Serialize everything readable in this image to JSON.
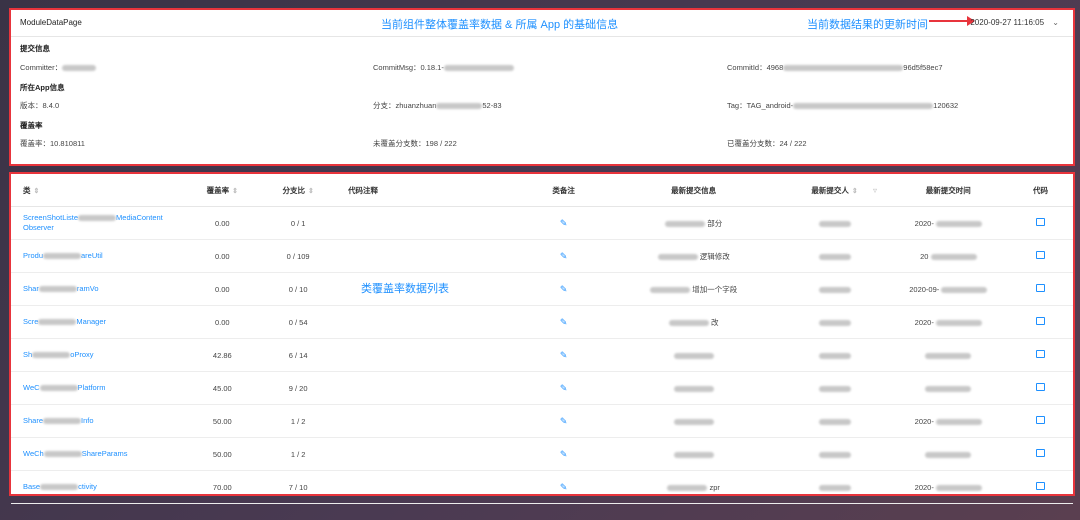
{
  "header": {
    "page_name": "ModuleDataPage",
    "annotation_center": "当前组件整体覆盖率数据 & 所属 App 的基础信息",
    "annotation_right": "当前数据结果的更新时间",
    "date_value": "2020-09-27 11:16:05"
  },
  "info": {
    "commit_section": "提交信息",
    "committer": "Committer：",
    "commit_msg": "CommitMsg：0.18.1-",
    "commit_id": "CommitId：4968",
    "commit_id_tail": "96d5f58ec7",
    "app_section": "所在App信息",
    "version": "版本：8.4.0",
    "branch": "分支：zhuanzhuan",
    "branch_tail": "52-83",
    "tag": "Tag：TAG_android-",
    "tag_tail": "120632",
    "coverage_section": "覆盖率",
    "coverage": "覆盖率：10.810811",
    "uncovered": "未覆盖分支数：198 / 222",
    "covered": "已覆盖分支数：24 / 222"
  },
  "table": {
    "annotation": "类覆盖率数据列表",
    "columns": {
      "cls": "类",
      "rate": "覆盖率",
      "ratio": "分支比",
      "note": "代码注释",
      "remark": "类备注",
      "latest_info": "最新提交信息",
      "latest_user": "最新提交人",
      "latest_time": "最新提交时间",
      "code": "代码"
    },
    "rows": [
      {
        "cls1": "ScreenShotListe",
        "cls2": "MediaContent",
        "cls3": "Observer",
        "rate": "0.00",
        "ratio": "0 / 1",
        "info": "部分",
        "time": "2020-"
      },
      {
        "cls1": "Produ",
        "cls2": "areUtil",
        "cls3": "",
        "rate": "0.00",
        "ratio": "0 / 109",
        "info": "逻辑修改",
        "time": "20"
      },
      {
        "cls1": "Shar",
        "cls2": "ramVo",
        "cls3": "",
        "rate": "0.00",
        "ratio": "0 / 10",
        "info": "增加一个字段",
        "time": "2020-09-"
      },
      {
        "cls1": "Scre",
        "cls2": "Manager",
        "cls3": "",
        "rate": "0.00",
        "ratio": "0 / 54",
        "info": "改",
        "time": "2020-"
      },
      {
        "cls1": "Sh",
        "cls2": "oProxy",
        "cls3": "",
        "rate": "42.86",
        "ratio": "6 / 14",
        "info": "",
        "time": ""
      },
      {
        "cls1": "WeC",
        "cls2": "Platform",
        "cls3": "",
        "rate": "45.00",
        "ratio": "9 / 20",
        "info": "",
        "time": ""
      },
      {
        "cls1": "Share",
        "cls2": "Info",
        "cls3": "",
        "rate": "50.00",
        "ratio": "1 / 2",
        "info": "",
        "time": "2020-"
      },
      {
        "cls1": "WeCh",
        "cls2": "ShareParams",
        "cls3": "",
        "rate": "50.00",
        "ratio": "1 / 2",
        "info": "",
        "time": ""
      },
      {
        "cls1": "Base",
        "cls2": "ctivity",
        "cls3": "",
        "rate": "70.00",
        "ratio": "7 / 10",
        "info": "zpr",
        "time": "2020-"
      }
    ]
  }
}
